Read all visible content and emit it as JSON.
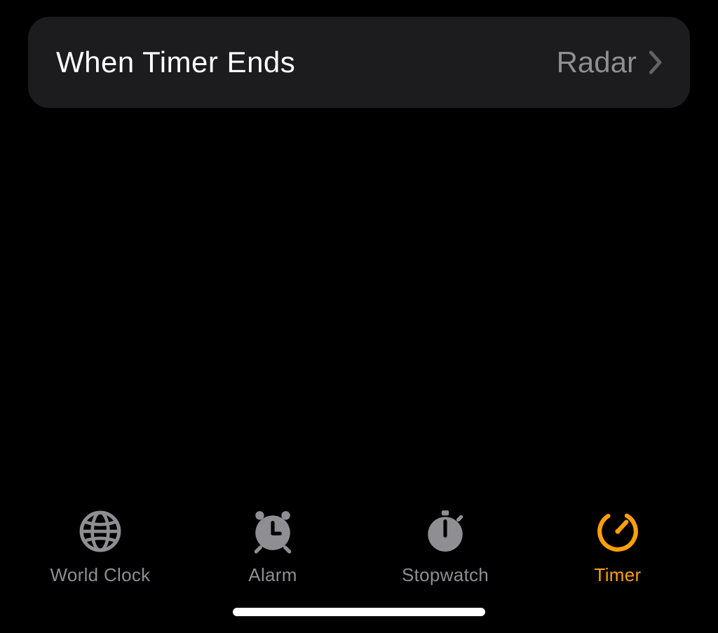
{
  "settings": {
    "label": "When Timer Ends",
    "value": "Radar"
  },
  "tabs": {
    "worldClock": {
      "label": "World Clock"
    },
    "alarm": {
      "label": "Alarm"
    },
    "stopwatch": {
      "label": "Stopwatch"
    },
    "timer": {
      "label": "Timer",
      "active": true
    }
  }
}
